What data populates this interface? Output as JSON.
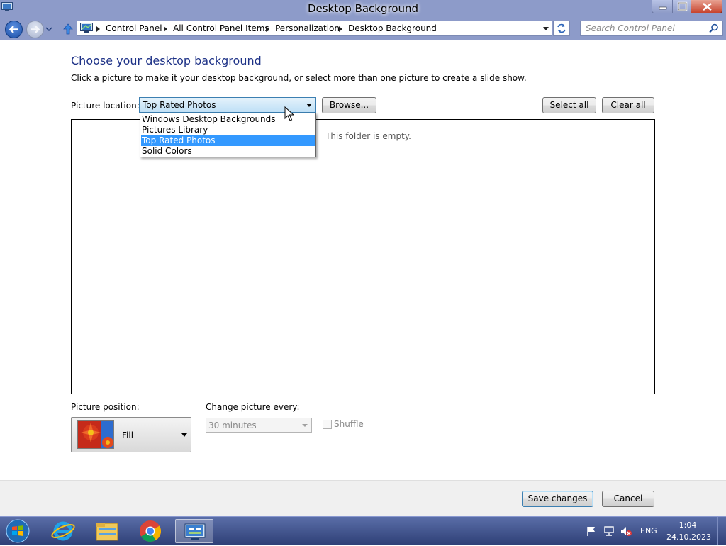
{
  "window": {
    "title": "Desktop Background"
  },
  "address_bar": {
    "breadcrumbs": [
      "Control Panel",
      "All Control Panel Items",
      "Personalization",
      "Desktop Background"
    ],
    "search_placeholder": "Search Control Panel"
  },
  "content": {
    "heading": "Choose your desktop background",
    "subheading": "Click a picture to make it your desktop background, or select more than one picture to create a slide show.",
    "picture_location_label": "Picture location:",
    "picture_location_value": "Top Rated Photos",
    "picture_location_options": [
      "Windows Desktop Backgrounds",
      "Pictures Library",
      "Top Rated Photos",
      "Solid Colors"
    ],
    "browse_label": "Browse...",
    "select_all_label": "Select all",
    "clear_all_label": "Clear all",
    "empty_message": "This folder is empty.",
    "picture_position_label": "Picture position:",
    "picture_position_value": "Fill",
    "change_picture_label": "Change picture every:",
    "change_picture_value": "30 minutes",
    "shuffle_label": "Shuffle"
  },
  "footer": {
    "save_label": "Save changes",
    "cancel_label": "Cancel"
  },
  "taskbar": {
    "apps": [
      "internet-explorer-icon",
      "file-explorer-icon",
      "chrome-icon",
      "control-panel-icon"
    ],
    "language": "ENG",
    "time": "1:04",
    "date": "24.10.2023"
  },
  "colors": {
    "title_bar": "#8d9bc9",
    "heading": "#1e3287",
    "selection": "#3399ff",
    "taskbar": "#3a4c88"
  }
}
